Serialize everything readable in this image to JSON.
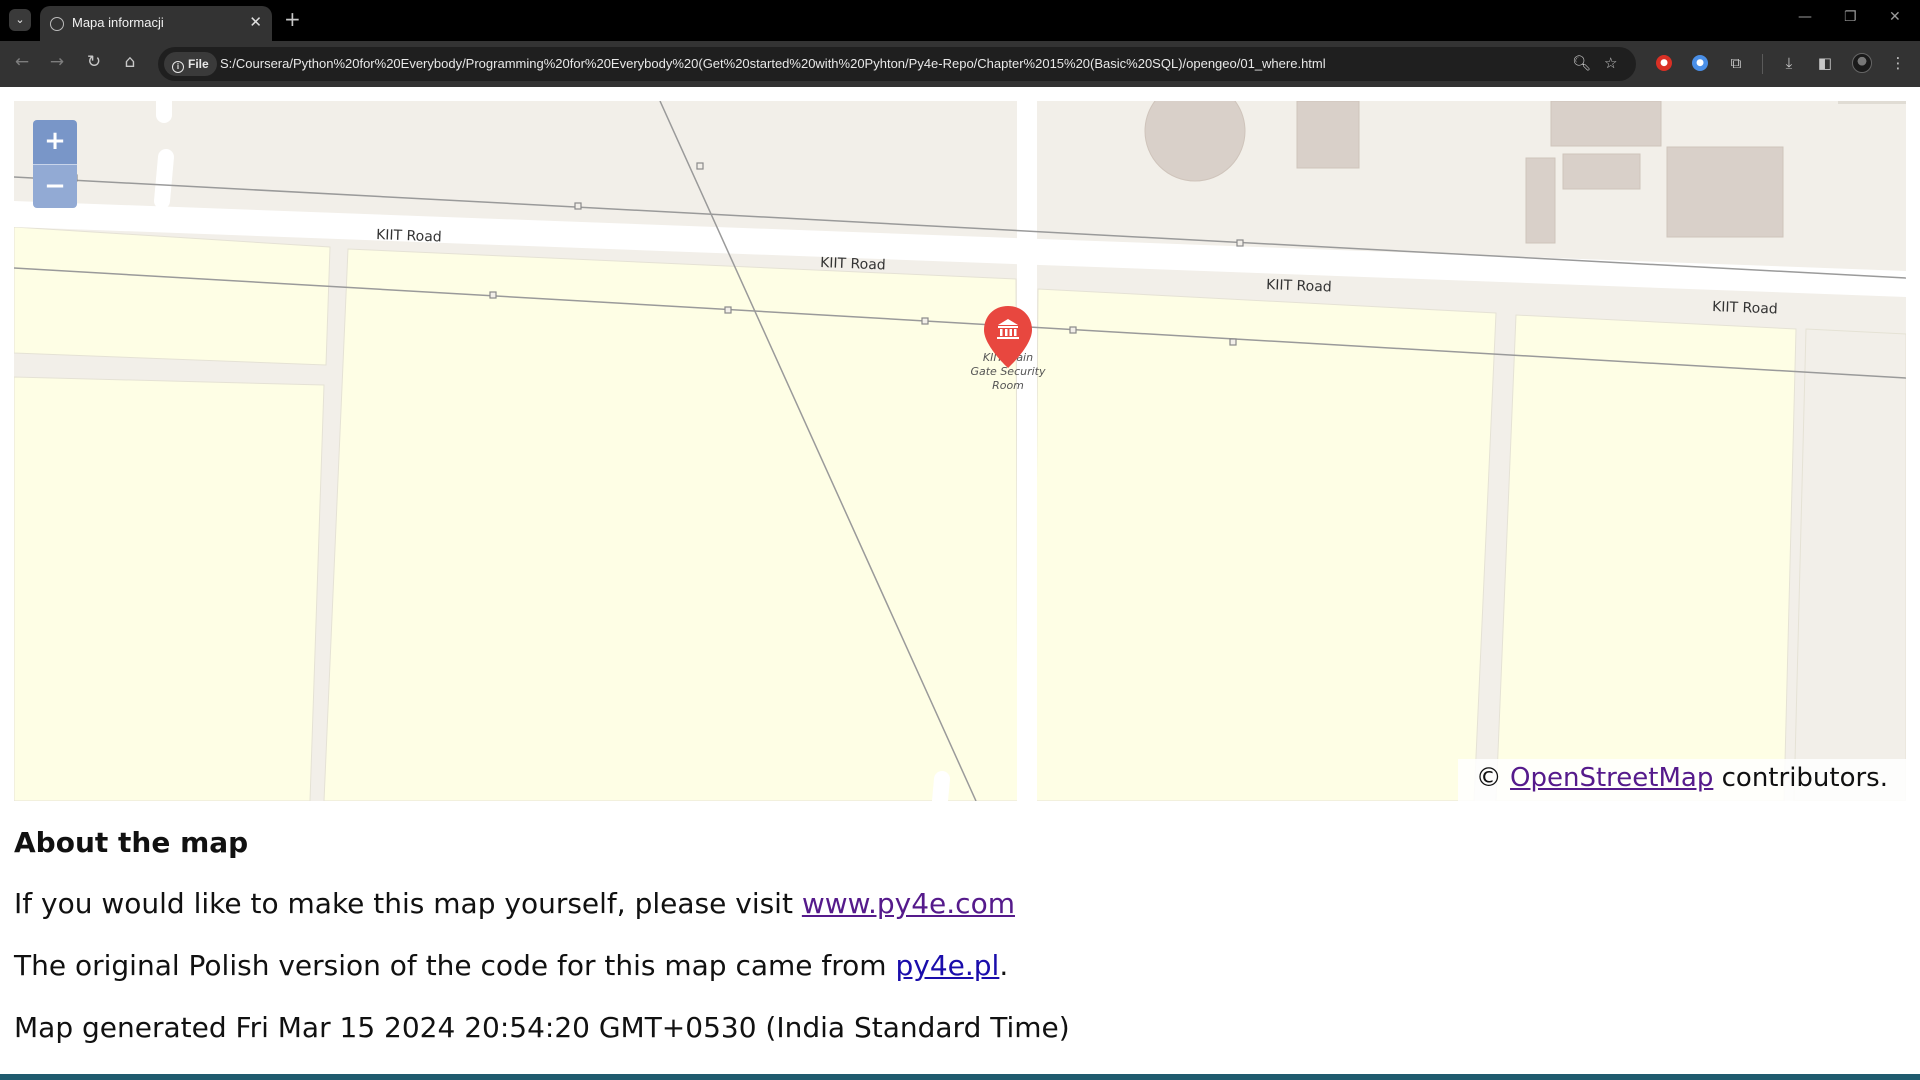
{
  "browser": {
    "tab_title": "Mapa informacji",
    "url_chip": "File",
    "url": "S:/Coursera/Python%20for%20Everybody/Programming%20for%20Everybody%20(Get%20started%20with%20Pyhton/Py4e-Repo/Chapter%2015%20(Basic%20SQL)/opengeo/01_where.html"
  },
  "map": {
    "zoom_in": "+",
    "zoom_out": "−",
    "road_labels": [
      "KIIT Road",
      "KIIT Road",
      "KIIT Road",
      "KIIT Road"
    ],
    "poi_label_lines": [
      "KIIT Main",
      "Gate Security",
      "Room"
    ],
    "marker_color": "#e8473f",
    "marker_icon": "museum-icon",
    "attribution_prefix": "©",
    "attribution_link": "OpenStreetMap",
    "attribution_suffix": "contributors."
  },
  "about": {
    "heading": "About the map",
    "p1_text": "If you would like to make this map yourself, please visit",
    "p1_link": "www.py4e.com",
    "p2_text": "The original Polish version of the code for this map came from",
    "p2_link": "py4e.pl",
    "p2_end": ".",
    "generated": "Map generated Fri Mar 15 2024 20:54:20 GMT+0530 (India Standard Time)"
  }
}
